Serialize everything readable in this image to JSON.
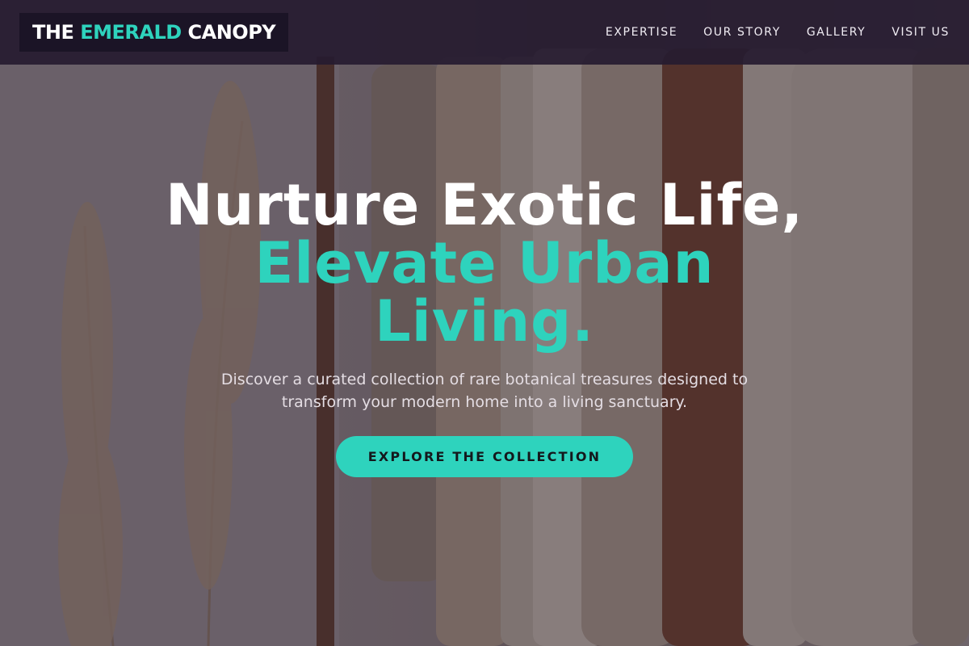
{
  "colors": {
    "accent": "#2ed3bd",
    "header_bg": "#261b30",
    "cta_text": "#14181c"
  },
  "brand": {
    "prefix": "THE",
    "accent_word": "EMERALD",
    "suffix": "CANOPY"
  },
  "nav": {
    "items": [
      {
        "label": "EXPERTISE"
      },
      {
        "label": "OUR STORY"
      },
      {
        "label": "GALLERY"
      },
      {
        "label": "VISIT US"
      }
    ]
  },
  "hero": {
    "headline_line1": "Nurture Exotic Life,",
    "headline_line2": "Elevate Urban",
    "headline_line3": "Living.",
    "subtitle": "Discover a curated collection of rare botanical treasures designed to transform your modern home into a living sanctuary.",
    "cta_label": "EXPLORE THE COLLECTION",
    "background_image": "clothing-rack-with-pampas-grass-photo"
  }
}
